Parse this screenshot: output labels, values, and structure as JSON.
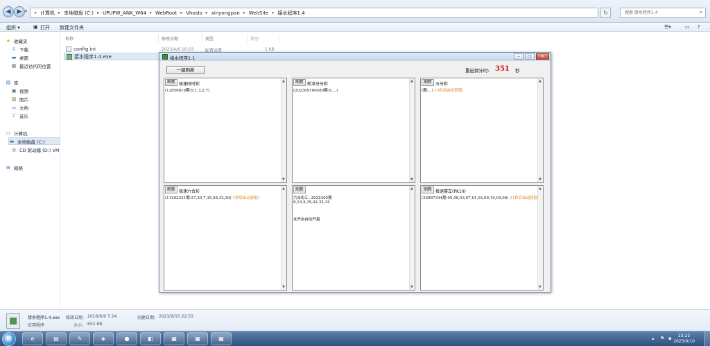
{
  "explorer": {
    "path": [
      "计算机",
      "本地磁盘 (C:)",
      "UPUPW_ANK_W64",
      "WebRoot",
      "Vhosts",
      "xinyongpan",
      "WebSite",
      "接水程序1.4"
    ],
    "search_placeholder": "搜索 接水程序1.4",
    "toolbar": {
      "organize": "组织 ▾",
      "open": "打开",
      "new_folder": "新建文件夹"
    },
    "sidebar": {
      "favorites": "收藏夹",
      "downloads": "下载",
      "desktop": "桌面",
      "recent": "最近访问的位置",
      "libraries": "库",
      "videos": "视频",
      "pictures": "图片",
      "documents": "文档",
      "music": "音乐",
      "computer": "计算机",
      "local_disk": "本地磁盘 (C:)",
      "cd_drive": "CD 驱动器 (D:) VM",
      "network": "网络"
    },
    "columns": {
      "name": "名称",
      "modified": "修改日期",
      "type": "类型",
      "size": "大小"
    },
    "files": [
      {
        "name": "config.ini",
        "modified": "2023/4/6 16:03",
        "type": "配置设置",
        "size": "1 KB"
      },
      {
        "name": "接水程序1.4.exe",
        "modified": "",
        "type": "",
        "size": ""
      }
    ],
    "details": {
      "name": "接水程序1.4.exe",
      "kind": "应用程序",
      "modified_label": "修改日期:",
      "modified": "2016/8/9 7:24",
      "created_label": "创建日期:",
      "created": "2023/9/10 22:53",
      "size_label": "大小:",
      "size": "652 KB"
    }
  },
  "taskbar": {
    "time": "23:22",
    "date": "2023/9/10",
    "start_glyph": "⊞"
  },
  "app": {
    "title": "接水程序1.1",
    "one_key_refresh": "一键刷新",
    "countdown_label": "重启倒计时:",
    "countdown_value": "351",
    "countdown_unit": "秒",
    "panels": [
      {
        "button": "刷新",
        "title": "极速时时彩",
        "lines": [
          {
            "text": "(12856610期:9,1,3,2,7)",
            "note": ""
          }
        ]
      },
      {
        "button": "刷新",
        "title": "新浪分分彩",
        "lines": [
          {
            "text": "(202309100480期:0,...)",
            "note": ""
          }
        ]
      },
      {
        "button": "刷新",
        "title": "五分彩",
        "lines": [
          {
            "text": "(期:...)",
            "note": "19秒后自动获取!"
          }
        ]
      },
      {
        "button": "刷新",
        "title": "极速六合彩",
        "lines": [
          {
            "text": "(11202231期:27,30,7,35,28,32,29)",
            "note": "1秒后自动获取!"
          }
        ]
      },
      {
        "button": "刷新",
        "title": "",
        "lines": [
          {
            "text": "六合彩汇: 2023102期",
            "note": ""
          },
          {
            "text": "8,19,4,39,42,32,34",
            "note": ""
          },
          {
            "text": "",
            "note": ""
          },
          {
            "text": "未开启自动开盘",
            "note": ""
          }
        ]
      },
      {
        "button": "刷新",
        "title": "极速赛车(PK10)",
        "lines": [
          {
            "text": "(32887344期:05,08,03,07,01,02,09,10,04,06)",
            "note": "21秒后自动获取!"
          }
        ]
      }
    ]
  }
}
